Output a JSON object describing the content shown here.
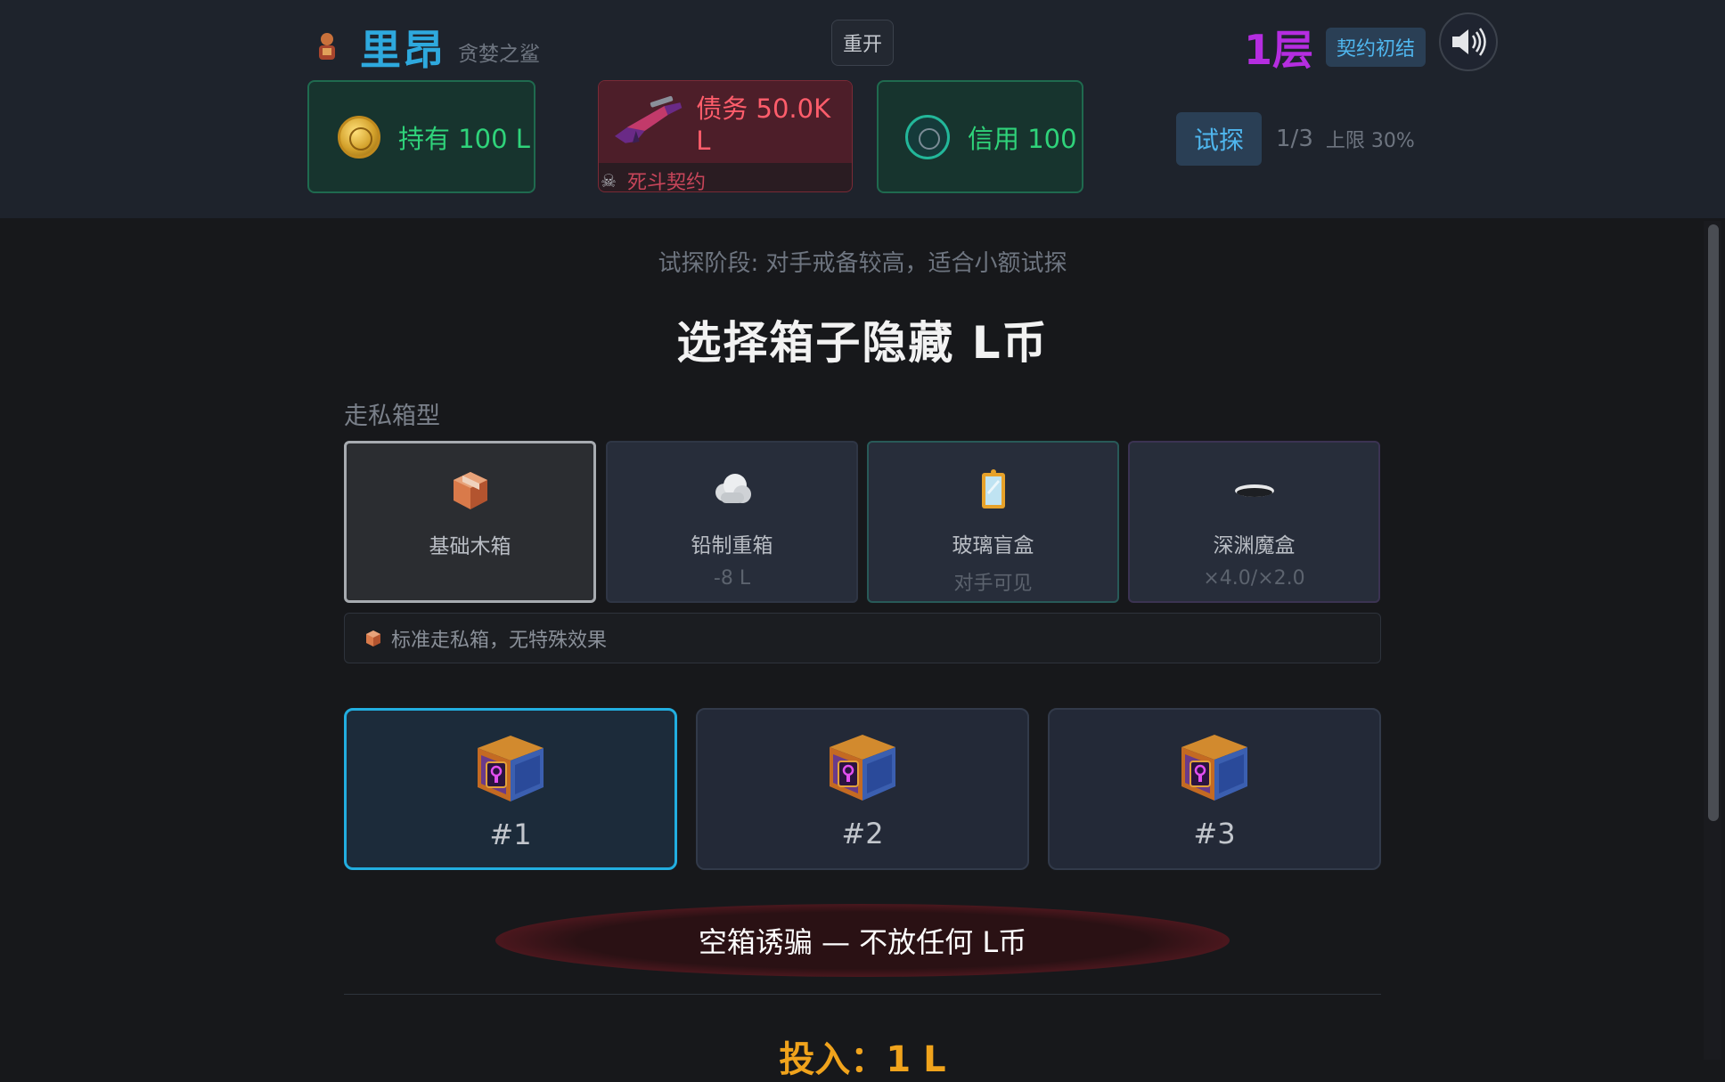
{
  "header": {
    "player_name": "里昂",
    "player_title": "贪婪之鲨",
    "restart_label": "重开",
    "floor": "1层",
    "floor_badge": "契约初结",
    "hold_label": "持有 100 L",
    "debt_label": "债务 50.0K L",
    "debt_contract": "死斗契约",
    "credit_label": "信用 100",
    "probe_label": "试探",
    "probe_count": "1/3",
    "probe_limit": "上限 30%"
  },
  "main": {
    "phase_hint": "试探阶段: 对手戒备较高，适合小额试探",
    "title": "选择箱子隐藏 L币",
    "section_label": "走私箱型",
    "box_types": [
      {
        "name": "基础木箱",
        "sub": "",
        "icon": "wooden-box-icon",
        "selected": true
      },
      {
        "name": "铅制重箱",
        "sub": "-8 L",
        "icon": "lead-cloud-icon"
      },
      {
        "name": "玻璃盲盒",
        "sub": "对手可见",
        "icon": "glass-mirror-icon"
      },
      {
        "name": "深渊魔盒",
        "sub": "×4.0/×2.0",
        "icon": "abyss-hole-icon"
      }
    ],
    "type_desc": "标准走私箱，无特殊效果",
    "boxes": [
      {
        "label": "#1",
        "selected": true
      },
      {
        "label": "#2"
      },
      {
        "label": "#3"
      }
    ],
    "decoy_label": "空箱诱骗 — 不放任何 L币",
    "stake_label": "投入：1 L"
  },
  "colors": {
    "accent_blue": "#22aee0",
    "green": "#2fd37a",
    "debt_red": "#ff5d6b",
    "floor_purple": "#b52de0",
    "stake_gold": "#f0a31c"
  }
}
